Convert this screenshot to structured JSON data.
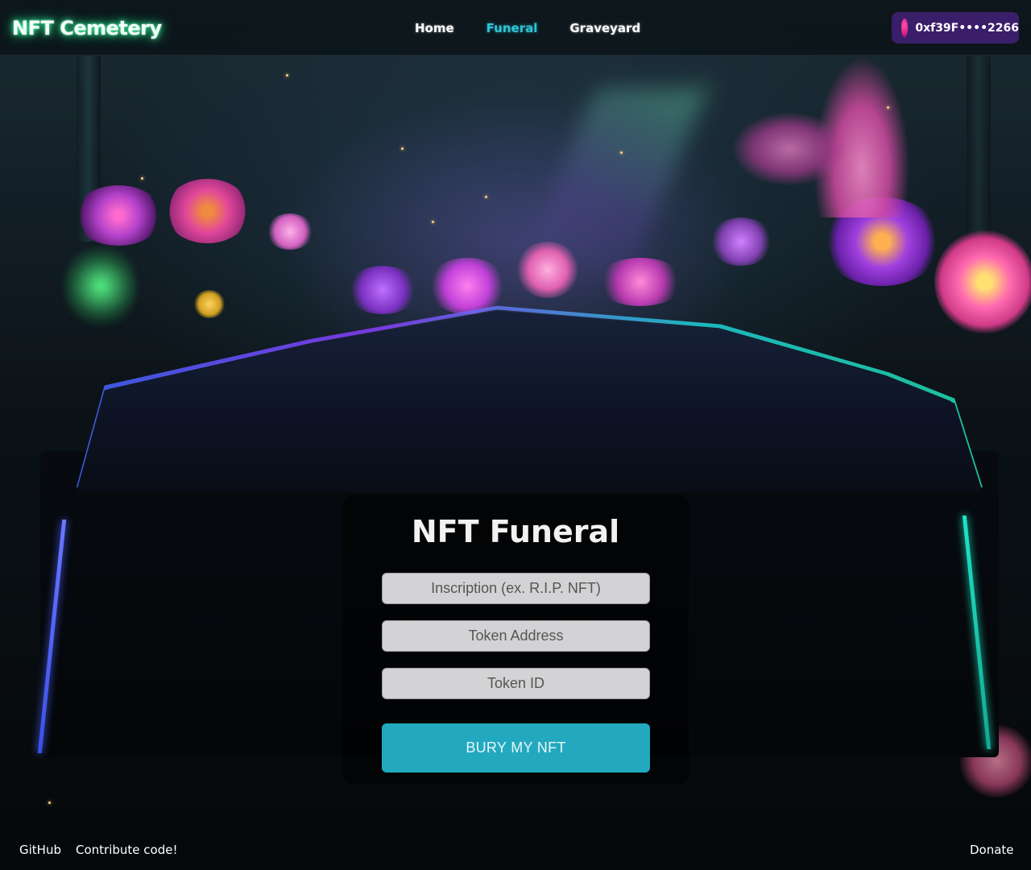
{
  "header": {
    "logo": "NFT Cemetery",
    "nav": [
      {
        "label": "Home",
        "active": false
      },
      {
        "label": "Funeral",
        "active": true
      },
      {
        "label": "Graveyard",
        "active": false
      }
    ],
    "wallet": {
      "address": "0xf39F••••2266",
      "avatar_color": "#e0308f"
    }
  },
  "funeral_form": {
    "title": "NFT Funeral",
    "inscription_placeholder": "Inscription (ex. R.I.P. NFT)",
    "token_address_placeholder": "Token Address",
    "token_id_placeholder": "Token ID",
    "submit_label": "BURY MY NFT"
  },
  "footer": {
    "github": "GitHub",
    "contribute": "Contribute code!",
    "donate": "Donate"
  },
  "colors": {
    "accent": "#2ec4d6",
    "button": "#22a9bf",
    "wallet_bg": "#3b1e6a",
    "logo_glow": "#3bffa0"
  }
}
